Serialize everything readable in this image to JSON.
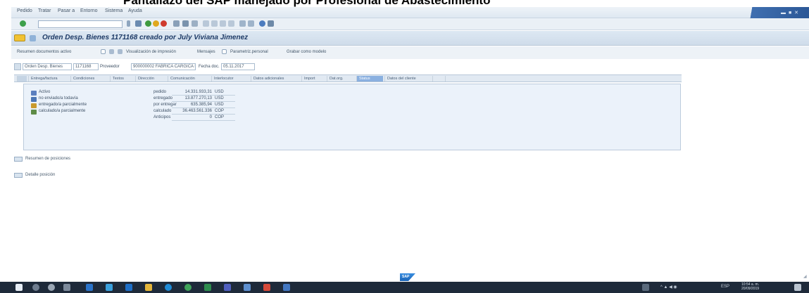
{
  "slide": {
    "title": "Pantallazo del SAP manejado por Profesional de Abastecimiento"
  },
  "menubar": {
    "items": [
      "Pedido",
      "Tratar",
      "Pasar a",
      "Entorno",
      "Sistema",
      "Ayuda"
    ]
  },
  "titlebar": {
    "title": "Orden Desp. Bienes 1171168 creado por July Viviana Jimenez"
  },
  "app_toolbar": {
    "buttons": [
      "Resumen documentos activo",
      "Visualización de impresión",
      "Mensajes",
      "Parametriz.personal",
      "Grabar como modelo"
    ]
  },
  "header": {
    "order_type_value": "Orden Desp. Bienes",
    "order_number_value": "1171168",
    "vendor_label": "Proveedor",
    "vendor_value": "900000002 FABRICA CARGICA DE",
    "date_label": "Fecha doc.",
    "date_value": "05.11.2017"
  },
  "tabs": [
    {
      "label": "Entrega/factura",
      "active": false
    },
    {
      "label": "Condiciones",
      "active": false
    },
    {
      "label": "Textos",
      "active": false
    },
    {
      "label": "Dirección",
      "active": false
    },
    {
      "label": "Comunicación",
      "active": false
    },
    {
      "label": "Interlocutor",
      "active": false
    },
    {
      "label": "Datos adicionales",
      "active": false
    },
    {
      "label": "Import",
      "active": false
    },
    {
      "label": "Dat.org.",
      "active": false
    },
    {
      "label": "Status",
      "active": true
    },
    {
      "label": "Datos del cliente",
      "active": false
    }
  ],
  "status": {
    "items": [
      {
        "label": "Activo",
        "icon": "document-icon",
        "color": "#5b7fbf"
      },
      {
        "label": "no enviado/a todavía",
        "icon": "send-icon",
        "color": "#4c76b5"
      },
      {
        "label": "entregado/a parcialmente",
        "icon": "truck-icon",
        "color": "#c99a2e"
      },
      {
        "label": "calculado/a parcialmente",
        "icon": "calc-icon",
        "color": "#5e8c47"
      }
    ],
    "figures": [
      {
        "label": "pedido",
        "amount": "14.331.933,31",
        "currency": "USD"
      },
      {
        "label": "entregado",
        "amount": "13.877.270,13",
        "currency": "USD"
      },
      {
        "label": "por entregar",
        "amount": "635.385,94",
        "currency": "USD"
      },
      {
        "label": "calculado",
        "amount": "36.463.561.336",
        "currency": "COP"
      },
      {
        "label": "Anticipos",
        "amount": "0",
        "currency": "COP"
      }
    ]
  },
  "sections": [
    {
      "label": "Resumen de posiciones"
    },
    {
      "label": "Detalle posición"
    }
  ],
  "taskbar": {
    "tray_lang": "ESP",
    "time": "10:54 a. m.",
    "date": "20/09/2019"
  },
  "colors": {
    "title_text": "#1d3a66",
    "active_tab": "#8ab0e0",
    "panel_bg": "#ebf2fa",
    "taskbar_bg": "#1e2a3a"
  }
}
